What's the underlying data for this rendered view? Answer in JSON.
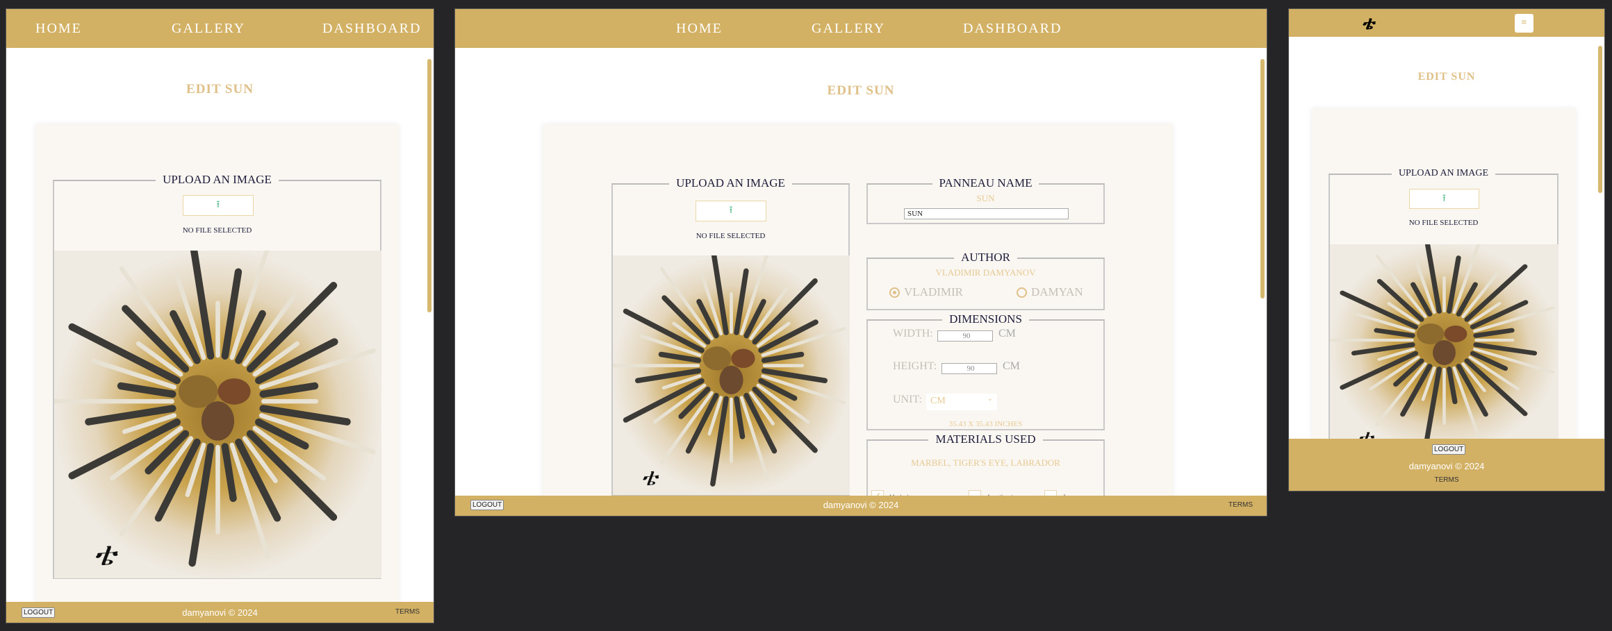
{
  "nav": {
    "home": "Home",
    "gallery": "Gallery",
    "dashboard": "Dashboard"
  },
  "page_title": "Edit Sun",
  "upload": {
    "legend": "Upload an image",
    "no_file": "No file selected",
    "icon": "upload-icon"
  },
  "panneau": {
    "legend": "Panneau Name",
    "current": "Sun",
    "input_value": "SUN"
  },
  "author": {
    "legend": "Author",
    "current": "Vladimir Damyanov",
    "options": [
      {
        "label": "Vladimir",
        "selected": true
      },
      {
        "label": "Damyan",
        "selected": false
      }
    ]
  },
  "dimensions": {
    "legend": "Dimensions",
    "width_label": "Width:",
    "width_value": "90",
    "height_label": "Height:",
    "height_value": "90",
    "unit_suffix": "cm",
    "unit_label": "Unit:",
    "unit_selected": "cm",
    "summary": "35.43 x 35.43 inches"
  },
  "materials": {
    "legend": "Materials used",
    "current": "Marbel, Tiger's eye, Labrador",
    "options": [
      {
        "label": "Marbel",
        "checked": true
      },
      {
        "label": "Amethyst",
        "checked": false
      },
      {
        "label": "Jasper",
        "checked": false
      }
    ]
  },
  "footer": {
    "logout": "Logout",
    "copyright": "damyanovi © 2024",
    "terms": "Terms"
  },
  "mobile": {
    "menu_icon": "hamburger-icon",
    "logo": "damyanovi-logo"
  },
  "colors": {
    "brand": "#d3b164",
    "accent_text": "#e0c089",
    "card_bg": "#faf7f2"
  }
}
